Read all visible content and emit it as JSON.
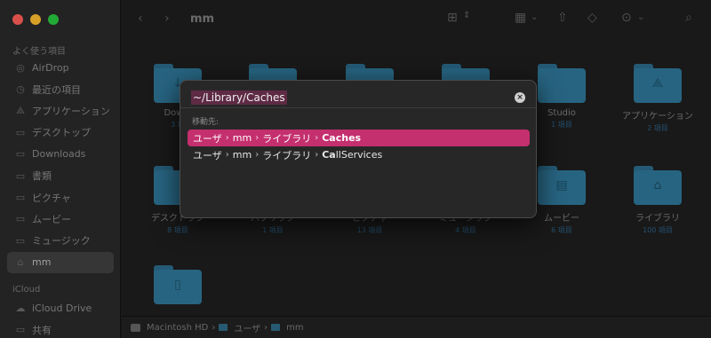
{
  "sidebar": {
    "favorites_header": "よく使う項目",
    "items": [
      {
        "label": "AirDrop",
        "icon": "airdrop-icon"
      },
      {
        "label": "最近の項目",
        "icon": "clock-icon"
      },
      {
        "label": "アプリケーション",
        "icon": "apps-icon"
      },
      {
        "label": "デスクトップ",
        "icon": "folder-icon"
      },
      {
        "label": "Downloads",
        "icon": "folder-icon"
      },
      {
        "label": "書類",
        "icon": "folder-icon"
      },
      {
        "label": "ピクチャ",
        "icon": "folder-icon"
      },
      {
        "label": "ムービー",
        "icon": "folder-icon"
      },
      {
        "label": "ミュージック",
        "icon": "folder-icon"
      },
      {
        "label": "mm",
        "icon": "home-icon"
      }
    ],
    "icloud_header": "iCloud",
    "icloud_items": [
      {
        "label": "iCloud Drive",
        "icon": "cloud-icon"
      },
      {
        "label": "共有",
        "icon": "shared-icon"
      }
    ]
  },
  "toolbar": {
    "title": "mm"
  },
  "grid": {
    "items": [
      {
        "name": "Downl",
        "count": "3 項"
      },
      {
        "name": "",
        "count": ""
      },
      {
        "name": "",
        "count": ""
      },
      {
        "name": "",
        "count": ""
      },
      {
        "name": "Studio",
        "count": "1 項目"
      },
      {
        "name": "アプリケーション",
        "count": "2 項目"
      },
      {
        "name": "デスクトップ",
        "count": "8 項目"
      },
      {
        "name": "パブリック",
        "count": "1 項目"
      },
      {
        "name": "ピクチャ",
        "count": "13 項目"
      },
      {
        "name": "ミュージック",
        "count": "4 項目"
      },
      {
        "name": "ムービー",
        "count": "6 項目"
      },
      {
        "name": "ライブラリ",
        "count": "100 項目"
      },
      {
        "name": "",
        "count": ""
      }
    ]
  },
  "pathbar": {
    "segments": [
      "Macintosh HD",
      "ユーザ",
      "mm"
    ]
  },
  "dialog": {
    "input_value": "~/Library/Caches",
    "section_label": "移動先:",
    "suggestions": [
      {
        "parts": [
          "ユーザ",
          "mm",
          "ライブラリ"
        ],
        "last": "Caches",
        "selected": true
      },
      {
        "parts": [
          "ユーザ",
          "mm",
          "ライブラリ"
        ],
        "last_bold": "Ca",
        "last_rest": "llServices",
        "selected": false
      }
    ]
  },
  "colors": {
    "accent": "#c42f6e",
    "folder": "#2e7698",
    "selection_text_bg": "#5e2a44"
  }
}
